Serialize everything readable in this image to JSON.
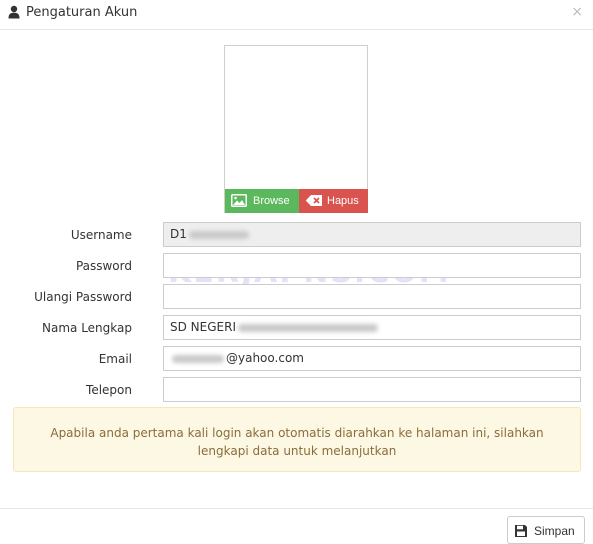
{
  "header": {
    "title": "Pengaturan Akun",
    "close_label": "×",
    "icon": "user-icon"
  },
  "photo": {
    "browse_label": "Browse",
    "hapus_label": "Hapus"
  },
  "form": {
    "username": {
      "label": "Username",
      "value_visible": "D1"
    },
    "password": {
      "label": "Password",
      "value": ""
    },
    "ulangi_password": {
      "label": "Ulangi Password",
      "value": ""
    },
    "nama_lengkap": {
      "label": "Nama Lengkap",
      "value_visible": "SD NEGERI"
    },
    "email": {
      "label": "Email",
      "value_visible": "@yahoo.com"
    },
    "telepon": {
      "label": "Telepon",
      "value": ""
    }
  },
  "notice": {
    "line1": "Apabila anda pertama kali login akan otomatis diarahkan ke halaman ini, silahkan",
    "line2": "lengkapi data untuk melanjutkan"
  },
  "footer": {
    "save_label": "Simpan"
  },
  "watermark": "KERJAPNS.COM",
  "colors": {
    "browse": "#5cb85c",
    "hapus": "#d9534f",
    "notice_bg": "#fcf8e3",
    "notice_text": "#8a6d3b"
  }
}
